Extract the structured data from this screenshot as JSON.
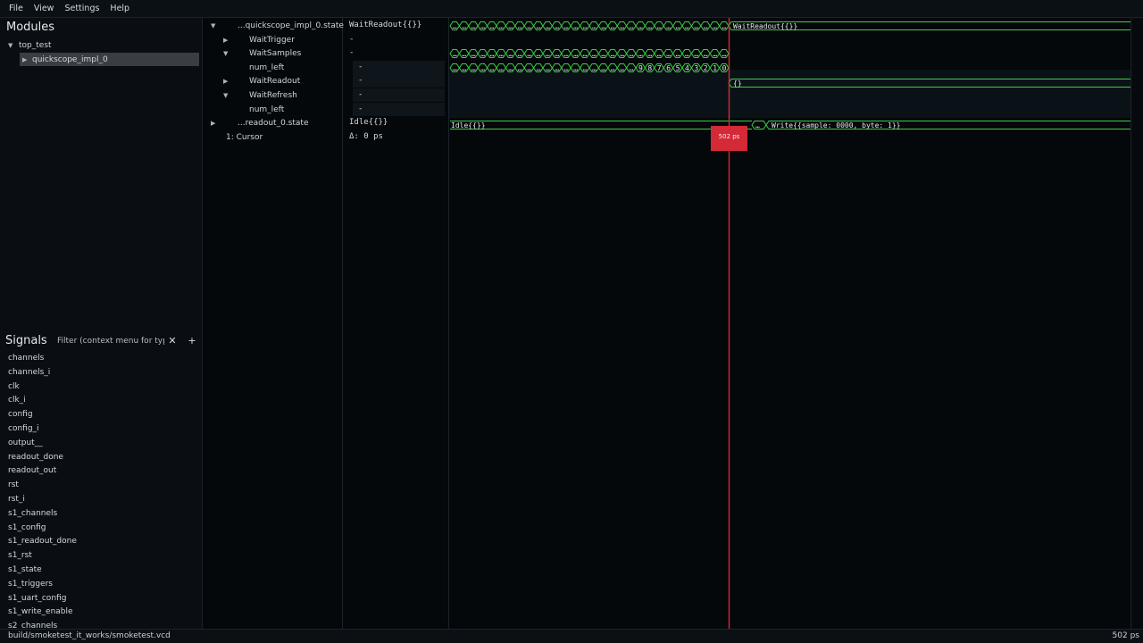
{
  "menu": [
    "File",
    "View",
    "Settings",
    "Help"
  ],
  "modules": {
    "title": "Modules",
    "items": [
      {
        "label": "top_test",
        "expanded": true
      },
      {
        "label": "quickscope_impl_0",
        "expanded": false,
        "selected": true
      }
    ]
  },
  "signals": {
    "title": "Signals",
    "filter_placeholder": "Filter (context menu for typ",
    "items": [
      "channels",
      "channels_i",
      "clk",
      "clk_i",
      "config",
      "config_i",
      "output__",
      "readout_done",
      "readout_out",
      "rst",
      "rst_i",
      "s1_channels",
      "s1_config",
      "s1_readout_done",
      "s1_rst",
      "s1_state",
      "s1_triggers",
      "s1_uart_config",
      "s1_write_enable",
      "s2_channels"
    ]
  },
  "wave_names": [
    {
      "label": "...quickscope_impl_0.state",
      "tri": "▼"
    },
    {
      "label": "WaitTrigger",
      "tri": "▶"
    },
    {
      "label": "WaitSamples",
      "tri": "▼"
    },
    {
      "label": "num_left",
      "tri": ""
    },
    {
      "label": "WaitReadout",
      "tri": "▶"
    },
    {
      "label": "WaitRefresh",
      "tri": "▼"
    },
    {
      "label": "num_left",
      "tri": ""
    },
    {
      "label": "...readout_0.state",
      "tri": "▶"
    },
    {
      "label": "1: Cursor",
      "tri": ""
    }
  ],
  "wave_values": [
    "WaitReadout{{}}",
    "-",
    "-",
    "-",
    "-",
    "-",
    "-",
    "Idle{{}}",
    "Δ: 0 ps"
  ],
  "waves": {
    "state_after_label": "WaitReadout{{}}",
    "elided_label": "…",
    "countdown": [
      "9",
      "8",
      "7",
      "6",
      "5",
      "4",
      "3",
      "2",
      "1",
      "0"
    ],
    "waitreadout_label": "{}",
    "readout_idle_label": "Idle{{}}",
    "readout_write_label": "Write{{sample: 0000, byte: 1}}",
    "readout_short_label": "…"
  },
  "cursor": {
    "time_label": "502 ps"
  },
  "status": {
    "file": "build/smoketest_it_works/smoketest.vcd",
    "time": "502 ps"
  },
  "colors": {
    "wave": "#3fcc45",
    "cursor": "#d42a37",
    "background": "#05080b"
  }
}
